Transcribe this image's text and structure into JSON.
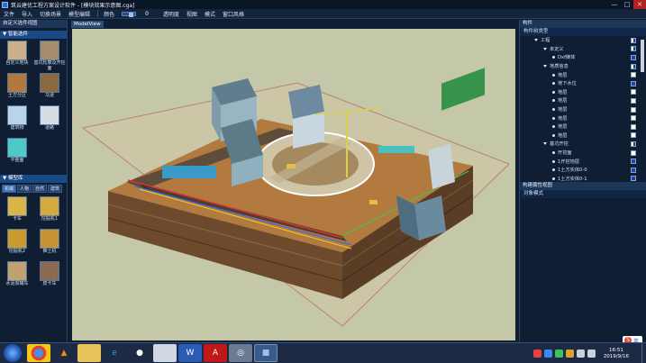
{
  "window": {
    "title": "筑云建优工程方案设计软件 - [模块效果示意图.cga]",
    "controls": {
      "minimize": "—",
      "maximize": "□",
      "close": "✕"
    }
  },
  "menu": {
    "items": [
      "文件",
      "导入",
      "切换场景",
      "模型编辑"
    ],
    "color_label": "颜色",
    "color_value": "0",
    "right_items": [
      "透明度",
      "视图",
      "模式",
      "窗口风格"
    ]
  },
  "left_panel": {
    "title": "自定义选件视图",
    "smart_section": "▼ 智能选件",
    "smart_items": [
      {
        "label": "自定义地块"
      },
      {
        "label": "基坑轮廓及开挖面"
      },
      {
        "label": "土方分区"
      },
      {
        "label": "马道"
      },
      {
        "label": "建筑物"
      },
      {
        "label": "道路"
      },
      {
        "label": "平整面"
      }
    ],
    "model_section": "▼ 模型库",
    "category_tabs": [
      "机械",
      "人物",
      "自然",
      "建筑"
    ],
    "model_items": [
      {
        "label": "卡车"
      },
      {
        "label": "挖掘机1"
      },
      {
        "label": "挖掘机2"
      },
      {
        "label": "推土机"
      },
      {
        "label": "水泥泵罐车"
      },
      {
        "label": "皮卡车"
      }
    ]
  },
  "viewport": {
    "tab": "ModelView"
  },
  "right_panel": {
    "title": "构件",
    "subtitle": "构件树类型",
    "tree": [
      {
        "label": "工程",
        "level": 0,
        "type": "arrow",
        "check": "half"
      },
      {
        "label": "未定义",
        "level": 1,
        "type": "arrow",
        "check": "half"
      },
      {
        "label": "Dxf媒体",
        "level": 2,
        "type": "bullet",
        "check": "blue"
      },
      {
        "label": "地质信息",
        "level": 1,
        "type": "arrow",
        "check": "half"
      },
      {
        "label": "地层",
        "level": 2,
        "type": "bullet",
        "check": "white"
      },
      {
        "label": "地下水位",
        "level": 2,
        "type": "bullet",
        "check": "blue"
      },
      {
        "label": "地层",
        "level": 2,
        "type": "bullet",
        "check": "white"
      },
      {
        "label": "地层",
        "level": 2,
        "type": "bullet",
        "check": "white"
      },
      {
        "label": "地层",
        "level": 2,
        "type": "bullet",
        "check": "white"
      },
      {
        "label": "地层",
        "level": 2,
        "type": "bullet",
        "check": "white"
      },
      {
        "label": "地层",
        "level": 2,
        "type": "bullet",
        "check": "white"
      },
      {
        "label": "地层",
        "level": 2,
        "type": "bullet",
        "check": "white"
      },
      {
        "label": "基坑开挖",
        "level": 1,
        "type": "arrow",
        "check": "half"
      },
      {
        "label": "开挖面",
        "level": 2,
        "type": "bullet",
        "check": "white"
      },
      {
        "label": "1开挖地层",
        "level": 2,
        "type": "bullet",
        "check": "blue"
      },
      {
        "label": "1土方实体0-0",
        "level": 2,
        "type": "bullet",
        "check": "blue"
      },
      {
        "label": "1土方实体0-1",
        "level": 2,
        "type": "bullet",
        "check": "blue"
      }
    ],
    "props_title": "构建属性视图",
    "props_row": "对象模式"
  },
  "taskbar": {
    "ime_label": "英",
    "time": "16:51",
    "date": "2019/9/16"
  }
}
